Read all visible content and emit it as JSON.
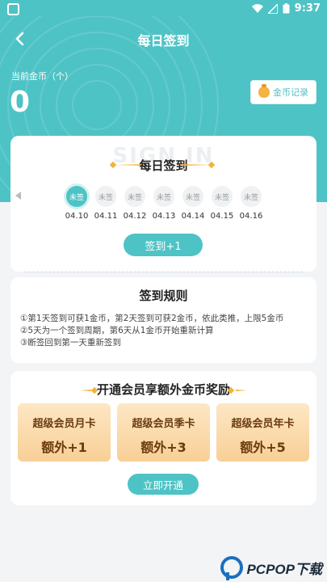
{
  "status_bar": {
    "time": "9:37"
  },
  "header": {
    "title": "每日签到"
  },
  "coins": {
    "label": "当前金币（个）",
    "count": "0",
    "record_label": "金币记录"
  },
  "sign_in": {
    "watermark": "SIGN IN",
    "title": "每日签到",
    "days": [
      {
        "status": "未签",
        "date": "04.10"
      },
      {
        "status": "未签",
        "date": "04.11"
      },
      {
        "status": "未签",
        "date": "04.12"
      },
      {
        "status": "未签",
        "date": "04.13"
      },
      {
        "status": "未签",
        "date": "04.14"
      },
      {
        "status": "未签",
        "date": "04.15"
      },
      {
        "status": "未签",
        "date": "04.16"
      }
    ],
    "button_label": "签到+1"
  },
  "rules": {
    "title": "签到规则",
    "lines": [
      "①第1天签到可获1金币，第2天签到可获2金币，依此类推，上限5金币",
      "②5天为一个签到周期，第6天从1金币开始重新计算",
      "③断签回到第一天重新签到"
    ]
  },
  "vip": {
    "title": "开通会员享额外金币奖励",
    "items": [
      {
        "name": "超级会员月卡",
        "bonus": "额外+1"
      },
      {
        "name": "超级会员季卡",
        "bonus": "额外+3"
      },
      {
        "name": "超级会员年卡",
        "bonus": "额外+5"
      }
    ],
    "button_label": "立即开通"
  },
  "watermark": {
    "text": "PCPOP下载"
  },
  "colors": {
    "accent": "#4ec3c5",
    "gold": "#f0b43c"
  }
}
